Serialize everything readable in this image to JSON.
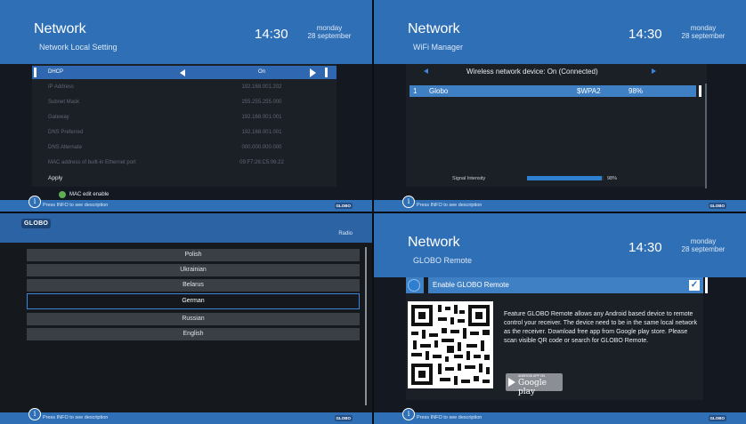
{
  "local": {
    "title": "Network",
    "subtitle": "Network Local Setting",
    "time": "14:30",
    "day": "monday",
    "date": "28 september",
    "rows": [
      {
        "label": "DHCP",
        "value": "On"
      },
      {
        "label": "IP Address",
        "value": "192.168.001.202"
      },
      {
        "label": "Subnet Mask",
        "value": "255.255.255.000"
      },
      {
        "label": "Gateway",
        "value": "192.168.001.001"
      },
      {
        "label": "DNS Preferred",
        "value": "192.168.001.001"
      },
      {
        "label": "DNS Alternate",
        "value": "000.000.000.000"
      },
      {
        "label": "MAC address of built-in Ethernet port",
        "value": "09:F7:26:C5:06:22"
      },
      {
        "label": "Apply",
        "value": ""
      }
    ],
    "mac_edit": "MAC edit enable",
    "footer": "Press INFO to see description",
    "footer_logo": "GLOBO"
  },
  "wifi": {
    "title": "Network",
    "subtitle": "WiFi Manager",
    "time": "14:30",
    "day": "monday",
    "date": "28 september",
    "device": "Wireless network device: On (Connected)",
    "networks": [
      {
        "index": "1",
        "ssid": "Globo",
        "security": "$WPA2",
        "strength": "98%"
      }
    ],
    "signal_label": "Signal Intensity",
    "signal_value": "98%",
    "signal_fraction": 0.98,
    "footer": "Press INFO to see description",
    "footer_logo": "GLOBO"
  },
  "language": {
    "logo": "GLOBO",
    "mode": "Radio",
    "items": [
      "Polish",
      "Ukrainian",
      "Belarus",
      "German",
      "Russian",
      "English"
    ],
    "selected": "German",
    "footer": "Press INFO to see description",
    "footer_logo": "GLOBO"
  },
  "remote": {
    "title": "Network",
    "subtitle": "GLOBO Remote",
    "time": "14:30",
    "day": "monday",
    "date": "28 september",
    "enable_label": "Enable GLOBO Remote",
    "enabled": true,
    "description": "Feature GLOBO Remote allows any Android based device to remote control your receiver. The device need to be in the same local network as the receiver. Download free app from Google play store. Please scan visible QR code or search for GLOBO Remote.",
    "badge_top": "ANDROID APP ON",
    "badge_store": "Google play",
    "footer": "Press INFO to see description",
    "footer_logo": "GLOBO"
  },
  "colors": {
    "header_blue": "#2e6fb6",
    "selection_blue": "#3f7fc4",
    "check_green": "#5fae53"
  },
  "icons": [
    "left-arrow-icon",
    "right-arrow-icon",
    "info-icon",
    "checkbox-icon",
    "globe-icon",
    "play-store-icon",
    "qr-code-icon"
  ]
}
